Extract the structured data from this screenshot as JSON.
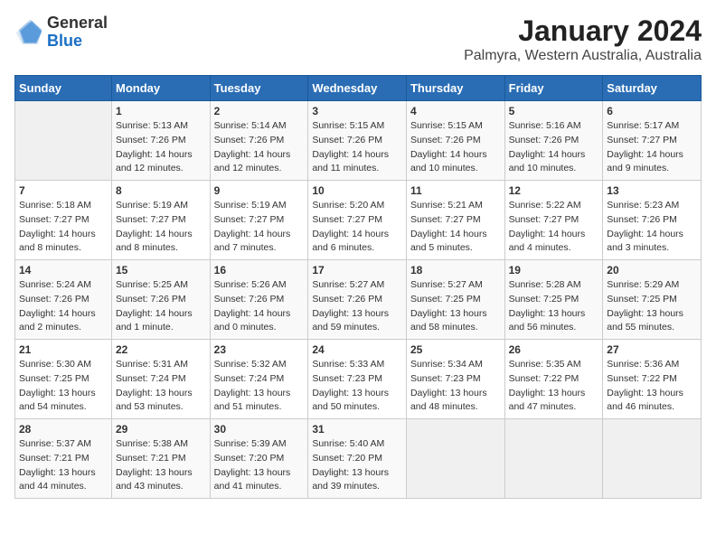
{
  "header": {
    "logo_general": "General",
    "logo_blue": "Blue",
    "title": "January 2024",
    "subtitle": "Palmyra, Western Australia, Australia"
  },
  "calendar": {
    "days_of_week": [
      "Sunday",
      "Monday",
      "Tuesday",
      "Wednesday",
      "Thursday",
      "Friday",
      "Saturday"
    ],
    "weeks": [
      [
        {
          "day": "",
          "info": ""
        },
        {
          "day": "1",
          "info": "Sunrise: 5:13 AM\nSunset: 7:26 PM\nDaylight: 14 hours\nand 12 minutes."
        },
        {
          "day": "2",
          "info": "Sunrise: 5:14 AM\nSunset: 7:26 PM\nDaylight: 14 hours\nand 12 minutes."
        },
        {
          "day": "3",
          "info": "Sunrise: 5:15 AM\nSunset: 7:26 PM\nDaylight: 14 hours\nand 11 minutes."
        },
        {
          "day": "4",
          "info": "Sunrise: 5:15 AM\nSunset: 7:26 PM\nDaylight: 14 hours\nand 10 minutes."
        },
        {
          "day": "5",
          "info": "Sunrise: 5:16 AM\nSunset: 7:26 PM\nDaylight: 14 hours\nand 10 minutes."
        },
        {
          "day": "6",
          "info": "Sunrise: 5:17 AM\nSunset: 7:27 PM\nDaylight: 14 hours\nand 9 minutes."
        }
      ],
      [
        {
          "day": "7",
          "info": "Sunrise: 5:18 AM\nSunset: 7:27 PM\nDaylight: 14 hours\nand 8 minutes."
        },
        {
          "day": "8",
          "info": "Sunrise: 5:19 AM\nSunset: 7:27 PM\nDaylight: 14 hours\nand 8 minutes."
        },
        {
          "day": "9",
          "info": "Sunrise: 5:19 AM\nSunset: 7:27 PM\nDaylight: 14 hours\nand 7 minutes."
        },
        {
          "day": "10",
          "info": "Sunrise: 5:20 AM\nSunset: 7:27 PM\nDaylight: 14 hours\nand 6 minutes."
        },
        {
          "day": "11",
          "info": "Sunrise: 5:21 AM\nSunset: 7:27 PM\nDaylight: 14 hours\nand 5 minutes."
        },
        {
          "day": "12",
          "info": "Sunrise: 5:22 AM\nSunset: 7:27 PM\nDaylight: 14 hours\nand 4 minutes."
        },
        {
          "day": "13",
          "info": "Sunrise: 5:23 AM\nSunset: 7:26 PM\nDaylight: 14 hours\nand 3 minutes."
        }
      ],
      [
        {
          "day": "14",
          "info": "Sunrise: 5:24 AM\nSunset: 7:26 PM\nDaylight: 14 hours\nand 2 minutes."
        },
        {
          "day": "15",
          "info": "Sunrise: 5:25 AM\nSunset: 7:26 PM\nDaylight: 14 hours\nand 1 minute."
        },
        {
          "day": "16",
          "info": "Sunrise: 5:26 AM\nSunset: 7:26 PM\nDaylight: 14 hours\nand 0 minutes."
        },
        {
          "day": "17",
          "info": "Sunrise: 5:27 AM\nSunset: 7:26 PM\nDaylight: 13 hours\nand 59 minutes."
        },
        {
          "day": "18",
          "info": "Sunrise: 5:27 AM\nSunset: 7:25 PM\nDaylight: 13 hours\nand 58 minutes."
        },
        {
          "day": "19",
          "info": "Sunrise: 5:28 AM\nSunset: 7:25 PM\nDaylight: 13 hours\nand 56 minutes."
        },
        {
          "day": "20",
          "info": "Sunrise: 5:29 AM\nSunset: 7:25 PM\nDaylight: 13 hours\nand 55 minutes."
        }
      ],
      [
        {
          "day": "21",
          "info": "Sunrise: 5:30 AM\nSunset: 7:25 PM\nDaylight: 13 hours\nand 54 minutes."
        },
        {
          "day": "22",
          "info": "Sunrise: 5:31 AM\nSunset: 7:24 PM\nDaylight: 13 hours\nand 53 minutes."
        },
        {
          "day": "23",
          "info": "Sunrise: 5:32 AM\nSunset: 7:24 PM\nDaylight: 13 hours\nand 51 minutes."
        },
        {
          "day": "24",
          "info": "Sunrise: 5:33 AM\nSunset: 7:23 PM\nDaylight: 13 hours\nand 50 minutes."
        },
        {
          "day": "25",
          "info": "Sunrise: 5:34 AM\nSunset: 7:23 PM\nDaylight: 13 hours\nand 48 minutes."
        },
        {
          "day": "26",
          "info": "Sunrise: 5:35 AM\nSunset: 7:22 PM\nDaylight: 13 hours\nand 47 minutes."
        },
        {
          "day": "27",
          "info": "Sunrise: 5:36 AM\nSunset: 7:22 PM\nDaylight: 13 hours\nand 46 minutes."
        }
      ],
      [
        {
          "day": "28",
          "info": "Sunrise: 5:37 AM\nSunset: 7:21 PM\nDaylight: 13 hours\nand 44 minutes."
        },
        {
          "day": "29",
          "info": "Sunrise: 5:38 AM\nSunset: 7:21 PM\nDaylight: 13 hours\nand 43 minutes."
        },
        {
          "day": "30",
          "info": "Sunrise: 5:39 AM\nSunset: 7:20 PM\nDaylight: 13 hours\nand 41 minutes."
        },
        {
          "day": "31",
          "info": "Sunrise: 5:40 AM\nSunset: 7:20 PM\nDaylight: 13 hours\nand 39 minutes."
        },
        {
          "day": "",
          "info": ""
        },
        {
          "day": "",
          "info": ""
        },
        {
          "day": "",
          "info": ""
        }
      ]
    ]
  }
}
